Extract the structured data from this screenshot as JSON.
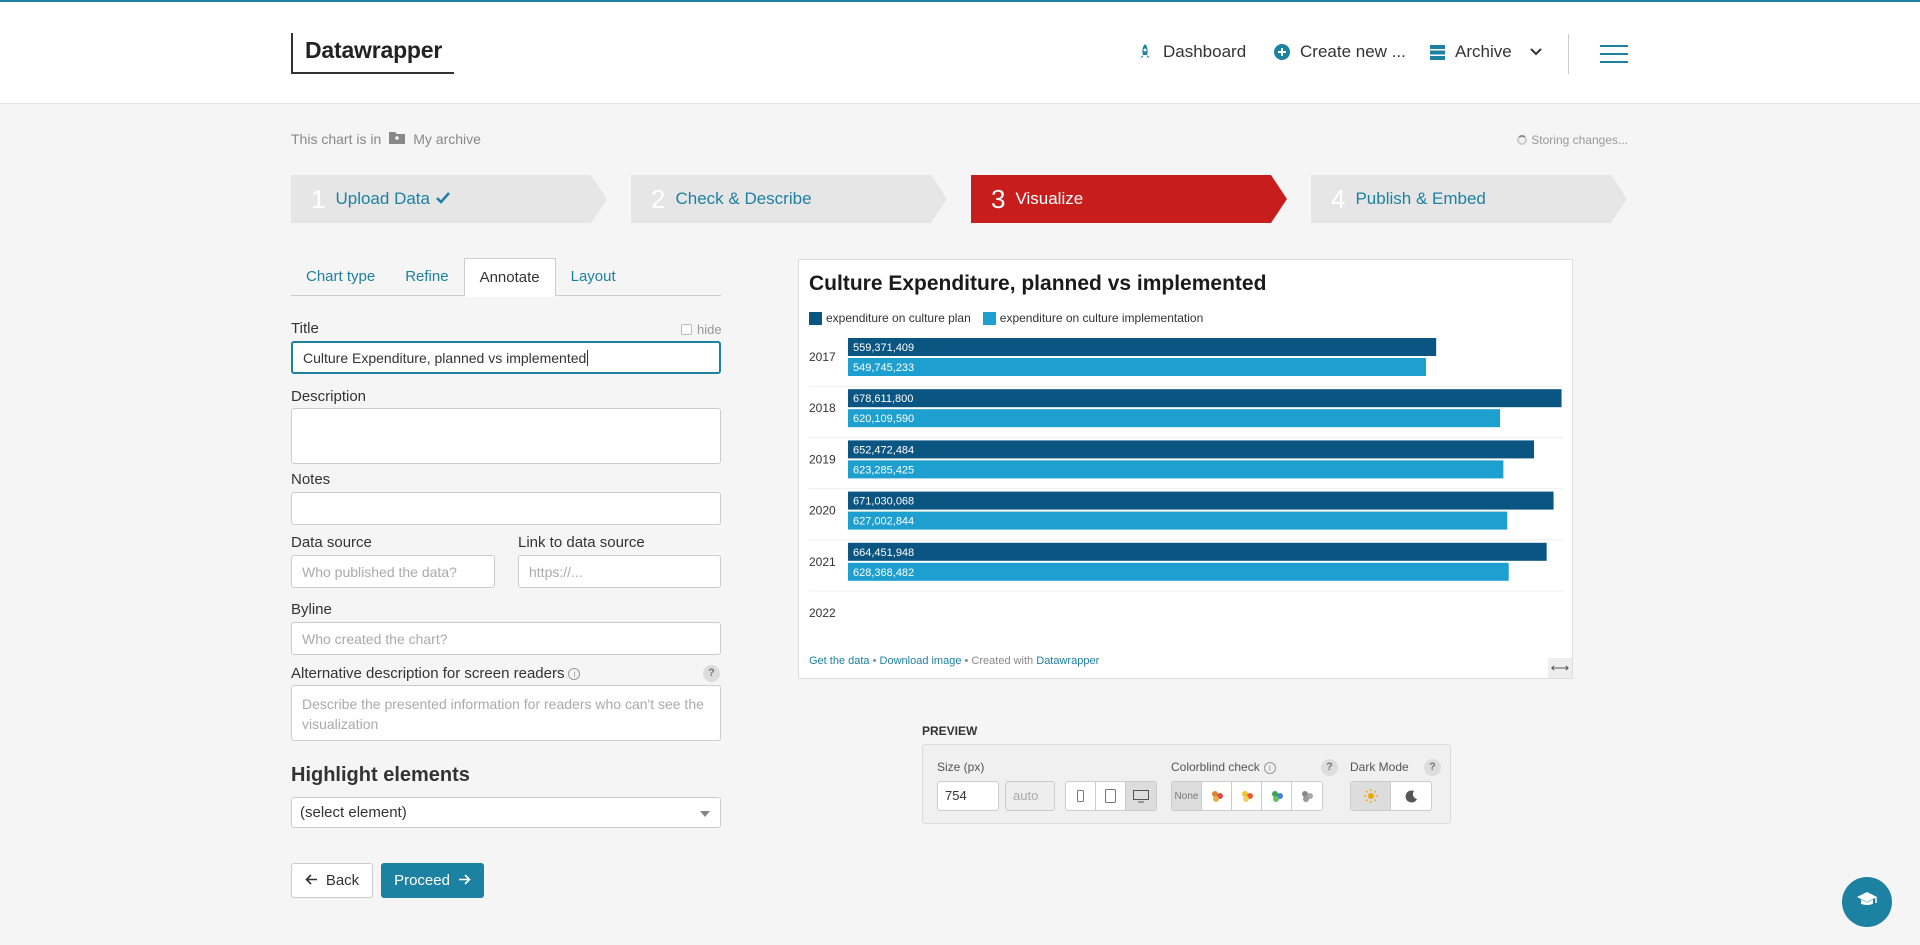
{
  "header": {
    "logo": "Datawrapper",
    "nav": [
      {
        "label": "Dashboard",
        "icon": "rocket-icon"
      },
      {
        "label": "Create new ...",
        "icon": "plus-circle-icon"
      },
      {
        "label": "Archive",
        "icon": "archive-icon"
      }
    ]
  },
  "breadcrumb": {
    "prefix": "This chart is in",
    "folder": "My archive"
  },
  "status": "Storing changes...",
  "steps": [
    {
      "num": "1",
      "label": "Upload Data"
    },
    {
      "num": "2",
      "label": "Check & Describe"
    },
    {
      "num": "3",
      "label": "Visualize"
    },
    {
      "num": "4",
      "label": "Publish & Embed"
    }
  ],
  "tabs": [
    "Chart type",
    "Refine",
    "Annotate",
    "Layout"
  ],
  "form": {
    "title_label": "Title",
    "hide_label": "hide",
    "title_value": "Culture Expenditure, planned vs implemented",
    "description_label": "Description",
    "notes_label": "Notes",
    "source_label": "Data source",
    "source_placeholder": "Who published the data?",
    "link_label": "Link to data source",
    "link_placeholder": "https://...",
    "byline_label": "Byline",
    "byline_placeholder": "Who created the chart?",
    "alt_label": "Alternative description for screen readers",
    "alt_placeholder": "Describe the presented information for readers who can't see the visualization",
    "highlight_heading": "Highlight elements",
    "highlight_select": "(select element)"
  },
  "buttons": {
    "back": "Back",
    "proceed": "Proceed"
  },
  "chart": {
    "footer_get_data": "Get the data",
    "footer_download": "Download image",
    "footer_created": "• Created with",
    "footer_brand": "Datawrapper"
  },
  "chart_data": {
    "type": "bar",
    "title": "Culture Expenditure, planned vs implemented",
    "categories": [
      "2017",
      "2018",
      "2019",
      "2020",
      "2021",
      "2022"
    ],
    "series": [
      {
        "name": "expenditure on culture plan",
        "color": "#0b5582",
        "values": [
          559371409,
          678611800,
          652472484,
          671030068,
          664451948,
          null
        ],
        "labels": [
          "559,371,409",
          "678,611,800",
          "652,472,484",
          "671,030,068",
          "664,451,948",
          ""
        ]
      },
      {
        "name": "expenditure on culture implementation",
        "color": "#1d9fd0",
        "values": [
          549745233,
          620109590,
          623285425,
          627002844,
          628368482,
          null
        ],
        "labels": [
          "549,745,233",
          "620,109,590",
          "623,285,425",
          "627,002,844",
          "628,368,482",
          ""
        ]
      }
    ],
    "xlim": [
      0,
      680000000
    ],
    "legend": "top-left"
  },
  "preview": {
    "label": "PREVIEW",
    "size_label": "Size (px)",
    "size_value": "754",
    "size_auto": "auto",
    "colorblind_label": "Colorblind check",
    "colorblind_none": "None",
    "darkmode_label": "Dark Mode"
  }
}
